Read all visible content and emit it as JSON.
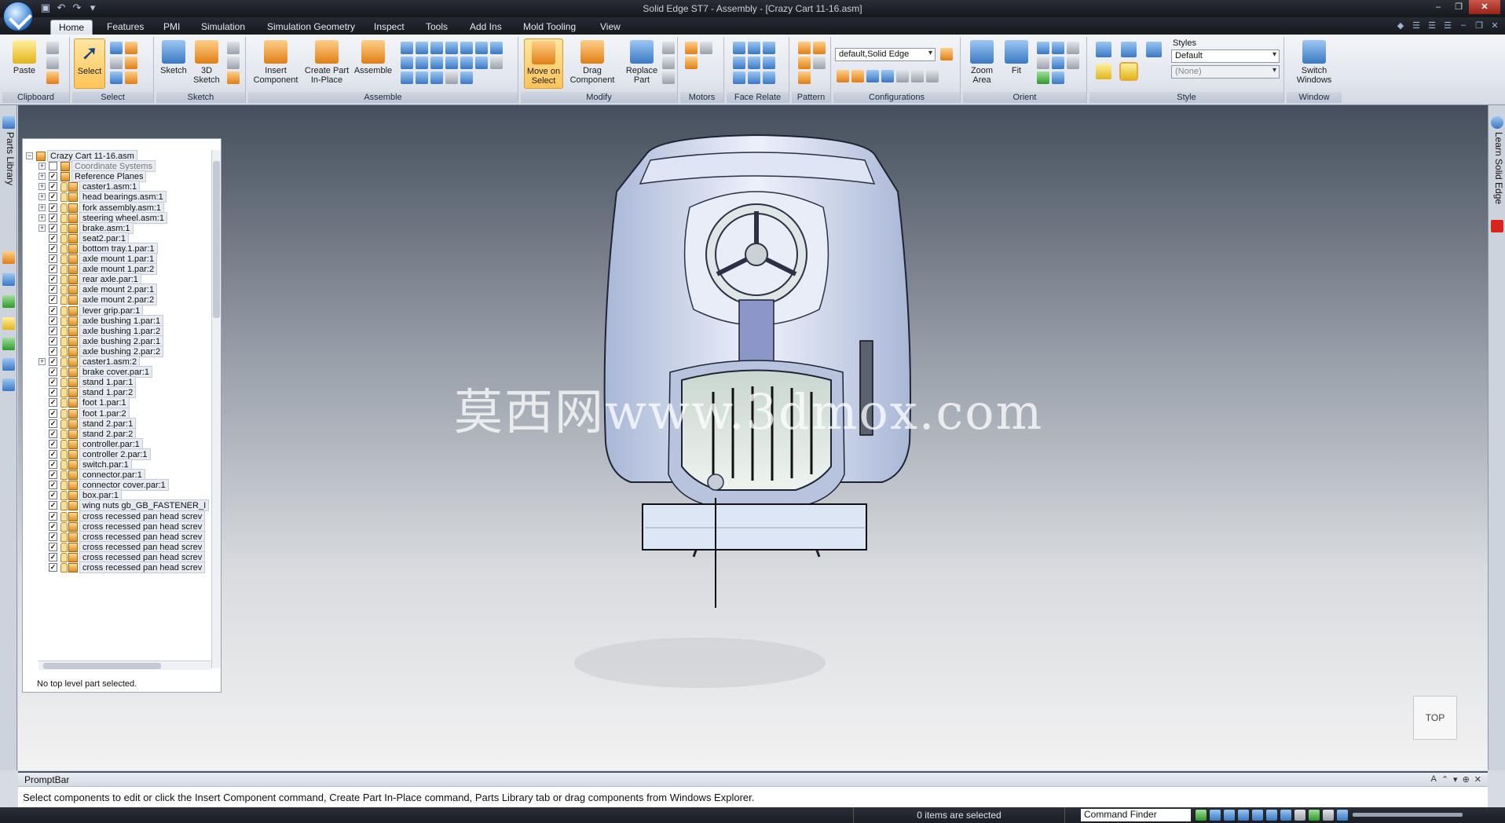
{
  "window": {
    "title": "Solid Edge ST7 - Assembly - [Crazy Cart 11-16.asm]",
    "buttons": [
      "–",
      "❐",
      "✕"
    ]
  },
  "ribbon": {
    "tabs": [
      "Home",
      "Features",
      "PMI",
      "Simulation",
      "Simulation Geometry",
      "Inspect",
      "Tools",
      "Add Ins",
      "Mold Tooling",
      "View"
    ],
    "active_tab": "Home",
    "groups": {
      "clipboard": {
        "label": "Clipboard",
        "paste": "Paste"
      },
      "select": {
        "label": "Select",
        "select": "Select"
      },
      "sketch": {
        "label": "Sketch",
        "sketch": "Sketch",
        "sketch3d": "3D Sketch"
      },
      "assemble": {
        "label": "Assemble",
        "insert": "Insert Component",
        "create_part": "Create Part In-Place",
        "assemble": "Assemble"
      },
      "modify": {
        "label": "Modify",
        "move_on_select": "Move on Select",
        "drag": "Drag Component",
        "replace": "Replace Part"
      },
      "motors": {
        "label": "Motors"
      },
      "face_relate": {
        "label": "Face Relate"
      },
      "pattern": {
        "label": "Pattern"
      },
      "configurations": {
        "label": "Configurations",
        "value": "default,Solid Edge"
      },
      "orient": {
        "label": "Orient",
        "zoom_area": "Zoom Area",
        "fit": "Fit"
      },
      "style": {
        "label": "Style",
        "styles": "Styles",
        "style_value": "Default",
        "face_value": "(None)"
      },
      "window": {
        "label": "Window",
        "switch": "Switch Windows"
      }
    }
  },
  "left_strip": {
    "parts_library": "Parts Library"
  },
  "right_strip": {
    "learn": "Learn Solid Edge"
  },
  "pathfinder": {
    "items": [
      {
        "label": "Crazy Cart 11-16.asm",
        "level": 0
      },
      {
        "label": "Coordinate Systems",
        "level": 1,
        "grey": true
      },
      {
        "label": "Reference Planes",
        "level": 1
      },
      {
        "label": "caster1.asm:1",
        "level": 1
      },
      {
        "label": "head bearings.asm:1",
        "level": 1
      },
      {
        "label": "fork assembly.asm:1",
        "level": 1
      },
      {
        "label": "steering wheel.asm:1",
        "level": 1
      },
      {
        "label": "brake.asm:1",
        "level": 1
      },
      {
        "label": "seat2.par:1",
        "level": 1
      },
      {
        "label": "bottom tray.1.par:1",
        "level": 1
      },
      {
        "label": "axle mount 1.par:1",
        "level": 1
      },
      {
        "label": "axle mount 1.par:2",
        "level": 1
      },
      {
        "label": "rear axle.par:1",
        "level": 1
      },
      {
        "label": "axle mount 2.par:1",
        "level": 1
      },
      {
        "label": "axle mount 2.par:2",
        "level": 1
      },
      {
        "label": "lever grip.par:1",
        "level": 1
      },
      {
        "label": "axle bushing 1.par:1",
        "level": 1
      },
      {
        "label": "axle bushing 1.par:2",
        "level": 1
      },
      {
        "label": "axle bushing 2.par:1",
        "level": 1
      },
      {
        "label": "axle bushing 2.par:2",
        "level": 1
      },
      {
        "label": "caster1.asm:2",
        "level": 1
      },
      {
        "label": "brake cover.par:1",
        "level": 1
      },
      {
        "label": "stand 1.par:1",
        "level": 1
      },
      {
        "label": "stand 1.par:2",
        "level": 1
      },
      {
        "label": "foot 1.par:1",
        "level": 1
      },
      {
        "label": "foot 1.par:2",
        "level": 1
      },
      {
        "label": "stand 2.par:1",
        "level": 1
      },
      {
        "label": "stand 2.par:2",
        "level": 1
      },
      {
        "label": "controller.par:1",
        "level": 1
      },
      {
        "label": "controller 2.par:1",
        "level": 1
      },
      {
        "label": "switch.par:1",
        "level": 1
      },
      {
        "label": "connector.par:1",
        "level": 1
      },
      {
        "label": "connector cover.par:1",
        "level": 1
      },
      {
        "label": "box.par:1",
        "level": 1
      },
      {
        "label": "wing nuts gb_GB_FASTENER_I",
        "level": 1
      },
      {
        "label": "cross recessed pan head screv",
        "level": 1
      },
      {
        "label": "cross recessed pan head screv",
        "level": 1
      },
      {
        "label": "cross recessed pan head screv",
        "level": 1
      },
      {
        "label": "cross recessed pan head screv",
        "level": 1
      },
      {
        "label": "cross recessed pan head screv",
        "level": 1
      },
      {
        "label": "cross recessed pan head screv",
        "level": 1
      }
    ],
    "status": "No top level part selected."
  },
  "viewport": {
    "watermark": "莫西网www.3dmox.com",
    "view_label": "TOP"
  },
  "promptbar": {
    "title": "PromptBar",
    "message": "Select components to edit or click the Insert Component command, Create Part In-Place command, Parts Library tab or drag components from Windows Explorer."
  },
  "statusbar": {
    "selection": "0 items are selected",
    "command_finder": "Command Finder"
  }
}
